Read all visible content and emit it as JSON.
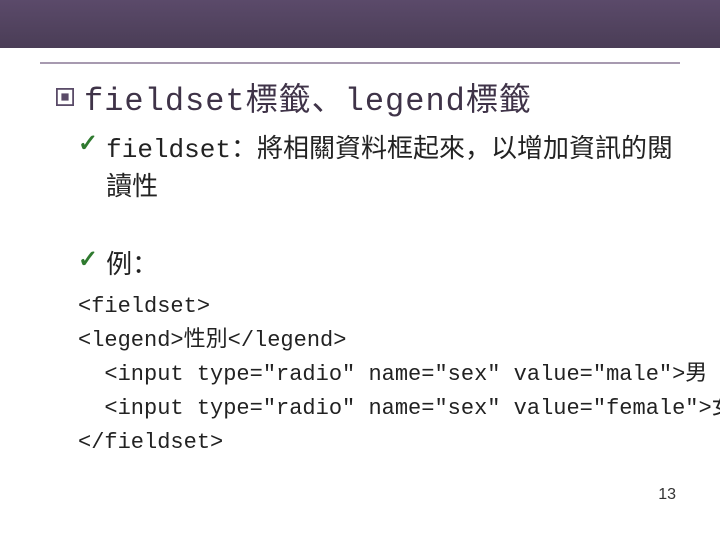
{
  "title": {
    "bullet_icon": "square-target-icon",
    "text_mono1": "fieldset",
    "text_mid": "標籤、",
    "text_mono2": "legend",
    "text_end": "標籤"
  },
  "bullets": [
    {
      "check": "✓",
      "lead_mono": "fieldset",
      "rest": "：將相關資料框起來，以增加資訊的閱讀性"
    },
    {
      "check": "✓",
      "lead_mono": "",
      "rest": "例："
    }
  ],
  "code_lines": [
    "<fieldset>",
    "<legend>性別</legend>",
    "  <input type=\"radio\" name=\"sex\" value=\"male\">男",
    "  <input type=\"radio\" name=\"sex\" value=\"female\">女",
    "</fieldset>"
  ],
  "page_number": "13"
}
